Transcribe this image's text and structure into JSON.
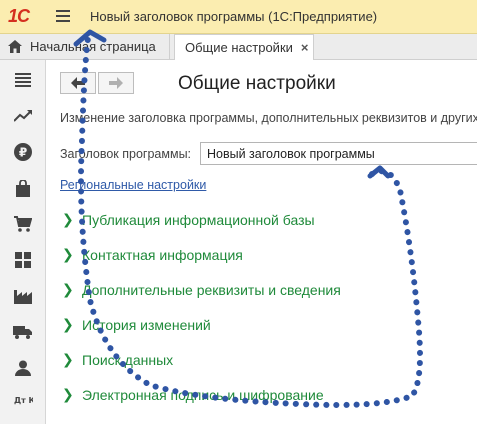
{
  "titlebar": {
    "logo": "1С",
    "title": "Новый заголовок программы  (1С:Предприятие)"
  },
  "tabs": {
    "home": "Начальная страница",
    "active": "Общие настройки",
    "close": "×"
  },
  "page": {
    "title": "Общие настройки",
    "description": "Изменение заголовка программы, дополнительных реквизитов и других",
    "field_label": "Заголовок программы:",
    "field_value": "Новый заголовок программы",
    "regional_link": "Региональные настройки"
  },
  "groups": [
    "Публикация информационной базы",
    "Контактная информация",
    "Дополнительные реквизиты и сведения",
    "История изменений",
    "Поиск данных",
    "Электронная подпись и шифрование"
  ],
  "sidebar_icons": [
    "menu-icon",
    "trend-icon",
    "ruble-icon",
    "bag-icon",
    "cart-icon",
    "grid-icon",
    "factory-icon",
    "truck-icon",
    "person-icon",
    "dt-kt-icon"
  ],
  "sidebar_labels": {
    "dt_kt": "Дт Кт"
  },
  "colors": {
    "titlebar": "#fbedb0",
    "group_text": "#1f8a3a",
    "link": "#2f5aa8",
    "annotation": "#2f55a4"
  }
}
